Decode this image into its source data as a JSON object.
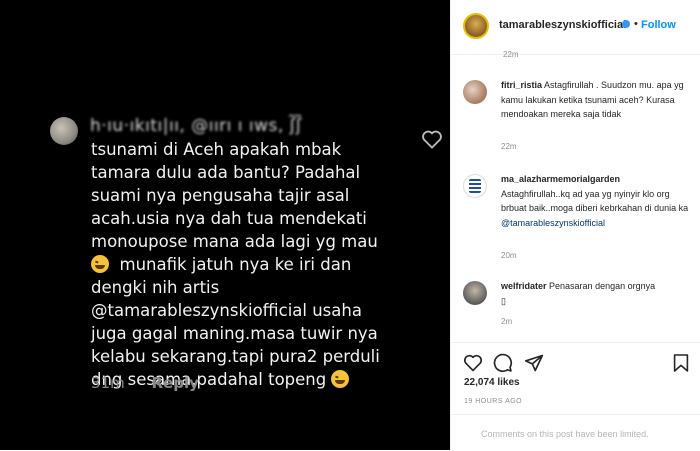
{
  "media": {
    "username_blurred": "h·ıu·ıkıtı|ıı, @ıırı ı ıws, ʃ̃ʃ̃",
    "comment_lines": [
      "tsunami di Aceh apakah mbak",
      "tamara dulu ada bantu? Padahal",
      "suami nya pengusaha tajir asal",
      "acah.usia nya dah tua mendekati",
      "monoupose mana ada lagi yg mau",
      "munafik jatuh nya ke iri dan",
      "dengki nih artis",
      "@tamarableszynskiofficial usaha",
      "juga gagal maning.masa tuwir nya",
      "kelabu sekarang.tapi pura2 perduli",
      "dng sesama.padahal topeng"
    ],
    "time": "31m",
    "reply_label": "Reply",
    "emoji": "grinning-squinting-face"
  },
  "post": {
    "header": {
      "username": "tamarableszynskiofficial",
      "separator": "•",
      "follow_label": "Follow"
    },
    "top_time": "22m",
    "comments": [
      {
        "username": "fitri_ristia",
        "text": "Astagfirullah . Suudzon mu. apa yg kamu lakukan ketika tsunami aceh? Kurasa mendoakan mereka saja tidak",
        "time": "22m"
      },
      {
        "username": "ma_alazharmemorialgarden",
        "text": "Astaghfirullah..kq ad yaa yg nyinyir klo org brbuat baik..moga diberi kebrkahan di dunia ka",
        "mention": "@tamarableszynskiofficial",
        "time": "20m"
      },
      {
        "username": "welfridater",
        "text": "Penasaran dengan orgnya",
        "glyph": "▯",
        "time": "2m"
      }
    ],
    "likes": "22,074 likes",
    "posted_ago": "19 HOURS AGO",
    "comments_limited": "Comments on this post have been limited."
  },
  "colors": {
    "link": "#0095f6",
    "verified": "#3897f0",
    "muted": "#8e8e8e"
  }
}
